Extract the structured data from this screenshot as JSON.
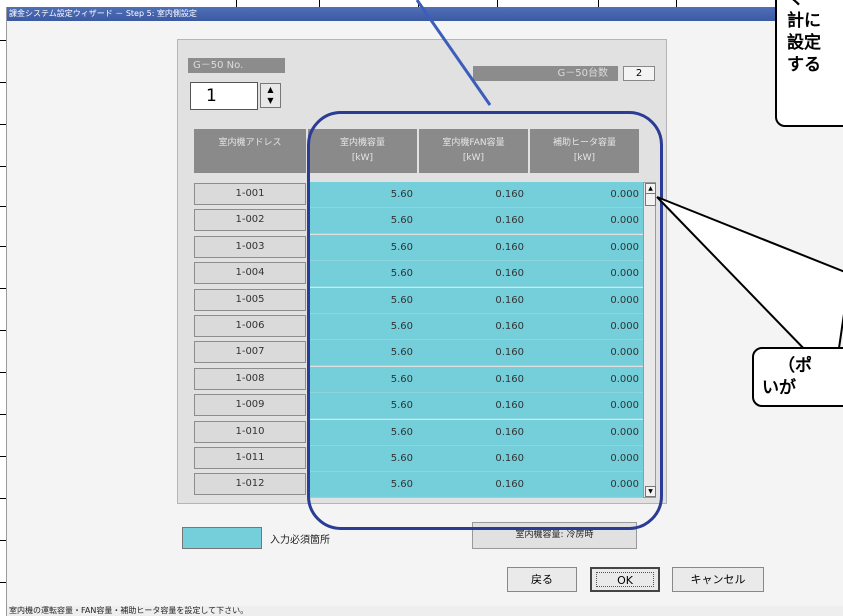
{
  "window": {
    "title": "課金システム設定ウィザード － Step 5: 室内側設定"
  },
  "g50": {
    "label": "G－50 No.",
    "value": "1",
    "count_label": "G－50台数",
    "count_value": "2"
  },
  "table": {
    "headers": [
      {
        "title": "室内機アドレス",
        "unit": ""
      },
      {
        "title": "室内機容量",
        "unit": "[kW]"
      },
      {
        "title": "室内機FAN容量",
        "unit": "[kW]"
      },
      {
        "title": "補助ヒータ容量",
        "unit": "[kW]"
      }
    ],
    "rows": [
      {
        "address": "1-001",
        "capacity": "5.60",
        "fan": "0.160",
        "heater": "0.000"
      },
      {
        "address": "1-002",
        "capacity": "5.60",
        "fan": "0.160",
        "heater": "0.000"
      },
      {
        "address": "1-003",
        "capacity": "5.60",
        "fan": "0.160",
        "heater": "0.000"
      },
      {
        "address": "1-004",
        "capacity": "5.60",
        "fan": "0.160",
        "heater": "0.000"
      },
      {
        "address": "1-005",
        "capacity": "5.60",
        "fan": "0.160",
        "heater": "0.000"
      },
      {
        "address": "1-006",
        "capacity": "5.60",
        "fan": "0.160",
        "heater": "0.000"
      },
      {
        "address": "1-007",
        "capacity": "5.60",
        "fan": "0.160",
        "heater": "0.000"
      },
      {
        "address": "1-008",
        "capacity": "5.60",
        "fan": "0.160",
        "heater": "0.000"
      },
      {
        "address": "1-009",
        "capacity": "5.60",
        "fan": "0.160",
        "heater": "0.000"
      },
      {
        "address": "1-010",
        "capacity": "5.60",
        "fan": "0.160",
        "heater": "0.000"
      },
      {
        "address": "1-011",
        "capacity": "5.60",
        "fan": "0.160",
        "heater": "0.000"
      },
      {
        "address": "1-012",
        "capacity": "5.60",
        "fan": "0.160",
        "heater": "0.000"
      }
    ]
  },
  "legend": {
    "required_label": "入力必須箇所",
    "capacity_note": "室内機容量: 冷房時"
  },
  "buttons": {
    "back": "戻る",
    "ok": "OK",
    "cancel": "キャンセル"
  },
  "status": "室内機の運転容量・FAN容量・補助ヒータ容量を設定して下さい。",
  "callouts": {
    "top": [
      "く",
      "計に",
      "設定",
      "する"
    ],
    "bottom": [
      "（ポ",
      "いが"
    ]
  },
  "colors": {
    "required_cell": "#74cfdb",
    "highlight_oval": "#2a3c95",
    "title_bar": "#3c5aa2"
  }
}
